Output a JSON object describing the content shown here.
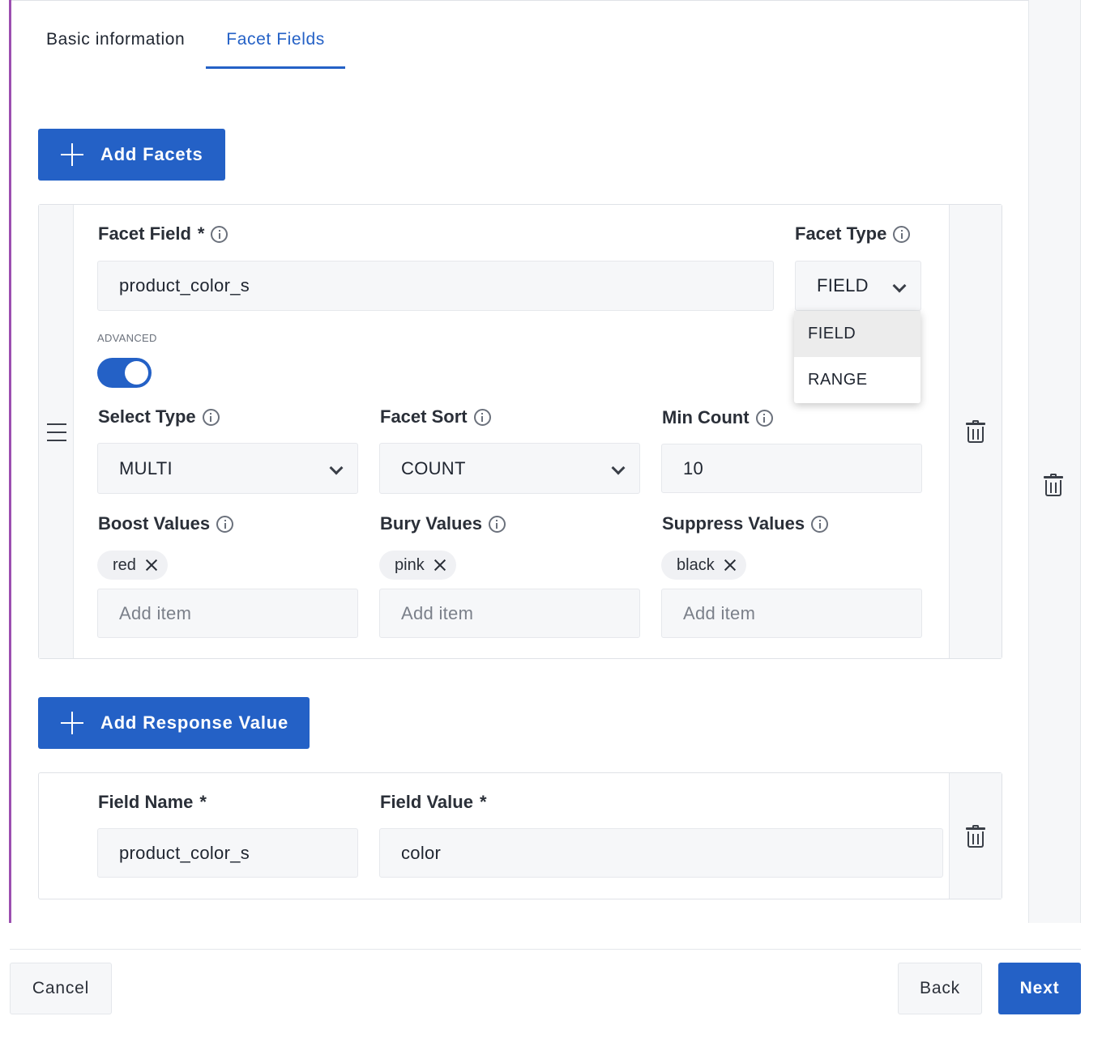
{
  "tabs": [
    {
      "label": "Basic information",
      "active": false
    },
    {
      "label": "Facet Fields",
      "active": true
    }
  ],
  "add_facets_label": "Add Facets",
  "facet": {
    "facet_field": {
      "label": "Facet Field",
      "required": "*",
      "value": "product_color_s"
    },
    "facet_type": {
      "label": "Facet Type",
      "value": "FIELD",
      "options": [
        "FIELD",
        "RANGE"
      ],
      "highlighted": "FIELD"
    },
    "advanced_label": "ADVANCED",
    "advanced_enabled": true,
    "select_type": {
      "label": "Select Type",
      "value": "MULTI"
    },
    "facet_sort": {
      "label": "Facet Sort",
      "value": "COUNT"
    },
    "min_count": {
      "label": "Min Count",
      "value": "10"
    },
    "boost_values": {
      "label": "Boost Values",
      "chips": [
        "red"
      ],
      "placeholder": "Add item"
    },
    "bury_values": {
      "label": "Bury Values",
      "chips": [
        "pink"
      ],
      "placeholder": "Add item"
    },
    "suppress_values": {
      "label": "Suppress Values",
      "chips": [
        "black"
      ],
      "placeholder": "Add item"
    }
  },
  "add_response_value_label": "Add Response Value",
  "response_value": {
    "field_name": {
      "label": "Field Name",
      "required": "*",
      "value": "product_color_s"
    },
    "field_value": {
      "label": "Field Value",
      "required": "*",
      "value": "color"
    }
  },
  "footer": {
    "cancel_label": "Cancel",
    "back_label": "Back",
    "next_label": "Next"
  },
  "colors": {
    "primary": "#2461c6",
    "accent_border": "#9c4fb0"
  }
}
